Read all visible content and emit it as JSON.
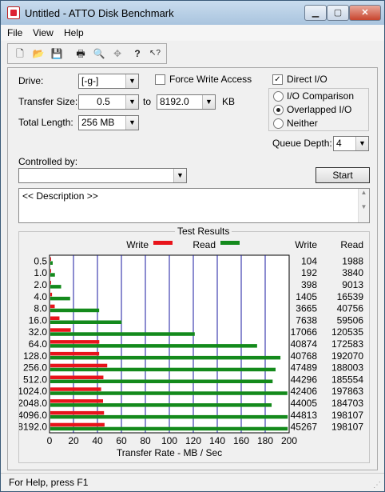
{
  "window": {
    "title": "Untitled - ATTO Disk Benchmark"
  },
  "menu": {
    "items": [
      "File",
      "View",
      "Help"
    ]
  },
  "toolbar": {
    "tools": [
      {
        "name": "new-icon",
        "glyph": "🗋"
      },
      {
        "name": "open-icon",
        "glyph": "📂"
      },
      {
        "name": "save-icon",
        "glyph": "💾"
      },
      {
        "name": "print-icon",
        "glyph": "🖶"
      },
      {
        "name": "print-preview-icon",
        "glyph": "🔍"
      },
      {
        "name": "move-icon",
        "glyph": "✥"
      },
      {
        "name": "help-icon",
        "glyph": "?"
      },
      {
        "name": "context-help-icon",
        "glyph": "↖?"
      }
    ]
  },
  "settings": {
    "drive_label": "Drive:",
    "drive_value": "[-g-]",
    "force_write_label": "Force Write Access",
    "direct_io_label": "Direct I/O",
    "direct_io_checked": true,
    "transfer_size_label": "Transfer Size:",
    "transfer_from": "0.5",
    "to_label": "to",
    "transfer_to": "8192.0",
    "kb_label": "KB",
    "total_length_label": "Total Length:",
    "total_length_value": "256 MB",
    "io_comparison_label": "I/O Comparison",
    "overlapped_io_label": "Overlapped I/O",
    "neither_label": "Neither",
    "queue_depth_label": "Queue Depth:",
    "queue_depth_value": "4",
    "controlled_by_label": "Controlled by:",
    "start_label": "Start",
    "description_text": "<< Description >>"
  },
  "results": {
    "title": "Test Results",
    "legend_write": "Write",
    "legend_read": "Read",
    "col_write": "Write",
    "col_read": "Read",
    "write_color": "#e8141b",
    "read_color": "#148a1c"
  },
  "chart_data": {
    "type": "bar",
    "orientation": "horizontal",
    "categories": [
      "0.5",
      "1.0",
      "2.0",
      "4.0",
      "8.0",
      "16.0",
      "32.0",
      "64.0",
      "128.0",
      "256.0",
      "512.0",
      "1024.0",
      "2048.0",
      "4096.0",
      "8192.0"
    ],
    "series": [
      {
        "name": "Write",
        "values": [
          104,
          192,
          398,
          1405,
          3665,
          7638,
          17066,
          40874,
          40768,
          47489,
          44296,
          42406,
          44005,
          44813,
          45267
        ]
      },
      {
        "name": "Read",
        "values": [
          1988,
          3840,
          9013,
          16539,
          40756,
          59506,
          120535,
          172583,
          192070,
          188003,
          185554,
          197863,
          184703,
          198107,
          198107
        ]
      }
    ],
    "xlabel": "Transfer Rate - MB / Sec",
    "xticks": [
      "0",
      "20",
      "40",
      "60",
      "80",
      "100",
      "120",
      "140",
      "160",
      "180",
      "200"
    ],
    "xlim": [
      0,
      200
    ],
    "grid": true,
    "legend": "top"
  },
  "status": {
    "text": "For Help, press F1"
  }
}
